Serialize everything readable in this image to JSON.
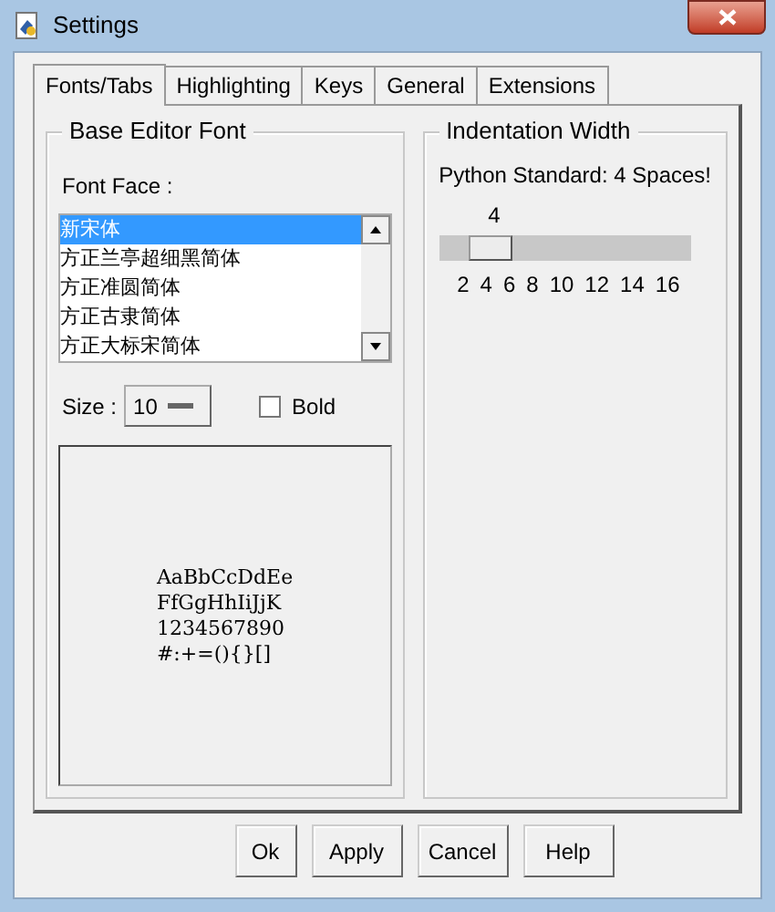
{
  "window": {
    "title": "Settings"
  },
  "tabs": [
    {
      "label": "Fonts/Tabs",
      "selected": true
    },
    {
      "label": "Highlighting",
      "selected": false
    },
    {
      "label": "Keys",
      "selected": false
    },
    {
      "label": "General",
      "selected": false
    },
    {
      "label": "Extensions",
      "selected": false
    }
  ],
  "base_editor_font": {
    "title": "Base Editor Font",
    "font_face_label": "Font Face :",
    "fonts": [
      {
        "name": "新宋体",
        "selected": true
      },
      {
        "name": "方正兰亭超细黑简体",
        "selected": false
      },
      {
        "name": "方正准圆简体",
        "selected": false
      },
      {
        "name": "方正古隶简体",
        "selected": false
      },
      {
        "name": "方正大标宋简体",
        "selected": false
      }
    ],
    "size_label": "Size :",
    "size_value": "10",
    "bold": {
      "label": "Bold",
      "checked": false
    },
    "sample": [
      "AaBbCcDdEe",
      "FfGgHhIiJjK",
      "1234567890",
      "#:+=(){}[]"
    ]
  },
  "indentation": {
    "title": "Indentation Width",
    "note": "Python Standard: 4 Spaces!",
    "value": "4",
    "level": 0.143,
    "ticks": [
      "2",
      "4",
      "6",
      "8",
      "10",
      "12",
      "14",
      "16"
    ]
  },
  "buttons": [
    "Ok",
    "Apply",
    "Cancel",
    "Help"
  ]
}
